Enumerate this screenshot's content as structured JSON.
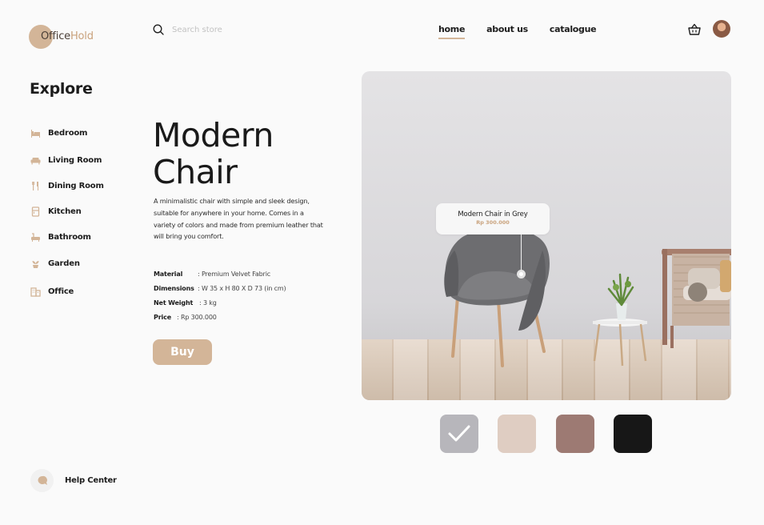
{
  "brand": {
    "name_part1": "Office",
    "name_part2": "Hold"
  },
  "search": {
    "placeholder": "Search store",
    "value": ""
  },
  "nav": {
    "items": [
      {
        "label": "home",
        "active": true
      },
      {
        "label": "about us",
        "active": false
      },
      {
        "label": "catalogue",
        "active": false
      }
    ]
  },
  "sidebar": {
    "title": "Explore",
    "items": [
      {
        "label": "Bedroom",
        "icon": "bed-icon"
      },
      {
        "label": "Living Room",
        "icon": "sofa-icon"
      },
      {
        "label": "Dining Room",
        "icon": "cutlery-icon"
      },
      {
        "label": "Kitchen",
        "icon": "fridge-icon"
      },
      {
        "label": "Bathroom",
        "icon": "bathtub-icon"
      },
      {
        "label": "Garden",
        "icon": "plant-icon"
      },
      {
        "label": "Office",
        "icon": "building-icon"
      }
    ],
    "help_label": "Help Center"
  },
  "product": {
    "title_line1": "Modern",
    "title_line2": "Chair",
    "description": "A minimalistic chair with simple and sleek design, suitable for anywhere in your home. Comes in a variety of colors and made from premium leather that will bring you comfort.",
    "specs": [
      {
        "label": "Material",
        "value": ": Premium Velvet Fabric"
      },
      {
        "label": "Dimensions",
        "value": ": W 35 x H 80 X D 73 (in cm)"
      },
      {
        "label": "Net Weight",
        "value": ": 3 kg"
      },
      {
        "label": "Price",
        "value": ": Rp 300.000"
      }
    ],
    "buy_label": "Buy"
  },
  "tooltip": {
    "title": "Modern Chair in Grey",
    "price": "Rp 300.000"
  },
  "swatches": [
    {
      "color": "#b7b6bb",
      "selected": true
    },
    {
      "color": "#dfcdc2",
      "selected": false
    },
    {
      "color": "#9d7a73",
      "selected": false
    },
    {
      "color": "#171717",
      "selected": false
    }
  ],
  "colors": {
    "accent": "#d3b598",
    "accent_text": "#c9a27c"
  }
}
